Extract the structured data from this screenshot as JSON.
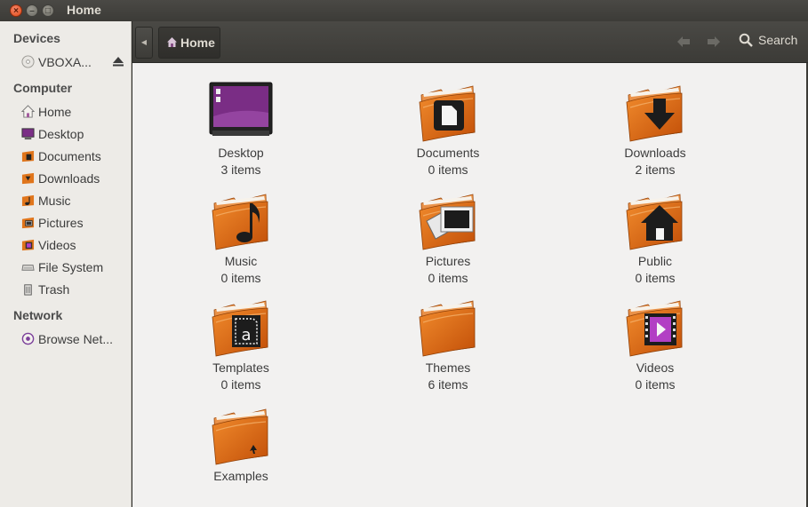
{
  "window": {
    "title": "Home"
  },
  "sidebar": {
    "sections": [
      {
        "label": "Devices"
      },
      {
        "label": "Computer"
      },
      {
        "label": "Network"
      }
    ],
    "devices": [
      {
        "label": "VBOXA..."
      }
    ],
    "computer": [
      {
        "label": "Home"
      },
      {
        "label": "Desktop"
      },
      {
        "label": "Documents"
      },
      {
        "label": "Downloads"
      },
      {
        "label": "Music"
      },
      {
        "label": "Pictures"
      },
      {
        "label": "Videos"
      },
      {
        "label": "File System"
      },
      {
        "label": "Trash"
      }
    ],
    "network": [
      {
        "label": "Browse Net..."
      }
    ]
  },
  "toolbar": {
    "breadcrumb": "Home",
    "search_label": "Search"
  },
  "files": [
    {
      "name": "Desktop",
      "count": "3 items"
    },
    {
      "name": "Documents",
      "count": "0 items"
    },
    {
      "name": "Downloads",
      "count": "2 items"
    },
    {
      "name": "Music",
      "count": "0 items"
    },
    {
      "name": "Pictures",
      "count": "0 items"
    },
    {
      "name": "Public",
      "count": "0 items"
    },
    {
      "name": "Templates",
      "count": "0 items"
    },
    {
      "name": "Themes",
      "count": "6 items"
    },
    {
      "name": "Videos",
      "count": "0 items"
    },
    {
      "name": "Examples",
      "count": ""
    }
  ],
  "colors": {
    "folder": "#e0751b",
    "accent": "#dd4814",
    "titlebar": "#3c3b37"
  }
}
